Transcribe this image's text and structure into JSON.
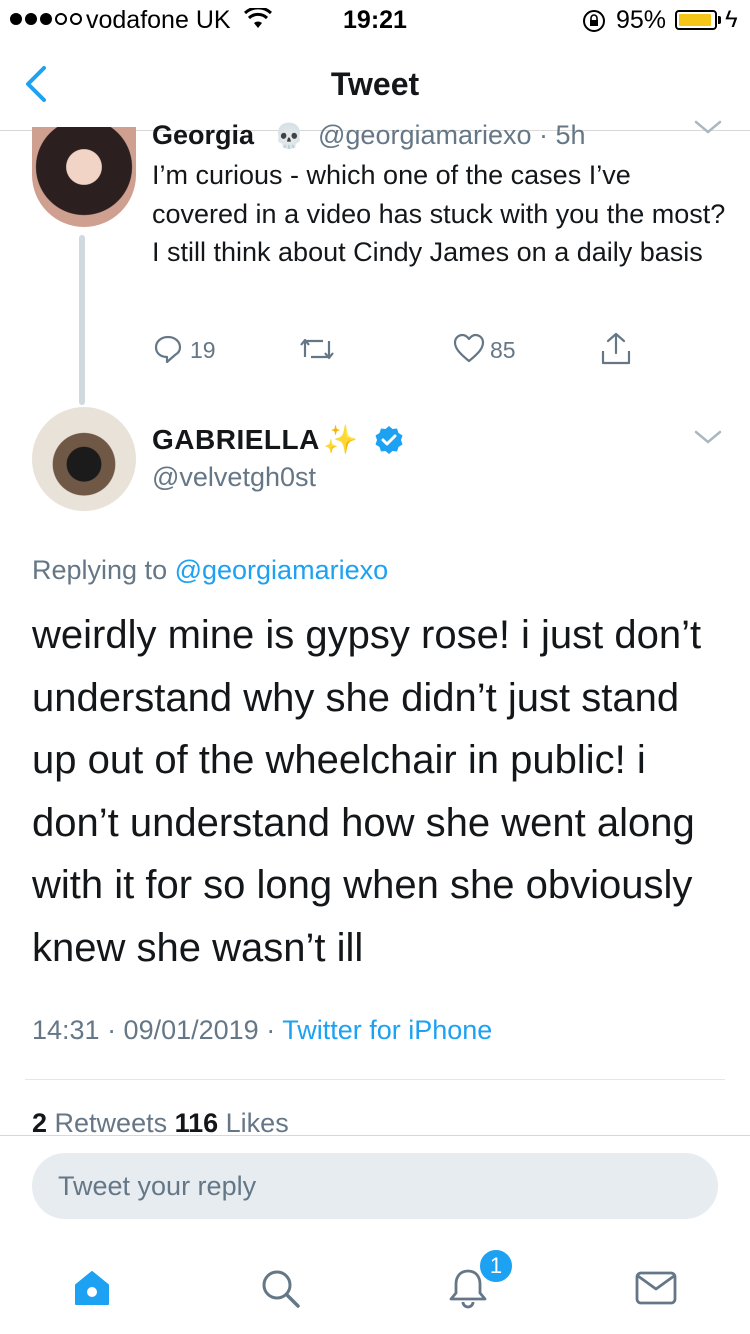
{
  "status_bar": {
    "carrier": "vodafone UK",
    "time": "19:21",
    "battery_percent": "95%",
    "battery_level": 0.95,
    "signal_bars": 3,
    "signal_total": 5
  },
  "nav": {
    "title": "Tweet",
    "back_icon": "chevron-left-icon"
  },
  "parent_tweet": {
    "name": "Georgia",
    "name_emoji": "💀",
    "handle_time": "@georgiamariexo · 5h",
    "text": "I’m curious - which one of the cases I’ve covered in a video has stuck with you the most? I still think about Cindy James on a daily basis",
    "reply_count": "19",
    "like_count": "85"
  },
  "focus_tweet": {
    "name": "GABRIELLA",
    "name_emoji": "✨",
    "handle": "@velvetgh0st",
    "replying_prefix": "Replying to ",
    "replying_to": "@georgiamariexo",
    "text": "weirdly mine is gypsy rose! i just don’t understand why she didn’t just stand up out of the wheelchair in public! i don’t understand how she went along with it for so long when she obviously knew she wasn’t ill",
    "timestamp": "14:31 · 09/01/2019 · ",
    "source": "Twitter for iPhone",
    "retweets_count": "2",
    "retweets_label": " Retweets ",
    "likes_count": "116",
    "likes_label": " Likes"
  },
  "composer": {
    "placeholder": "Tweet your reply"
  },
  "tabbar": {
    "notifications_badge": "1"
  },
  "colors": {
    "accent": "#1da1f2",
    "secondary_text": "#657786",
    "primary_text": "#14171a"
  }
}
